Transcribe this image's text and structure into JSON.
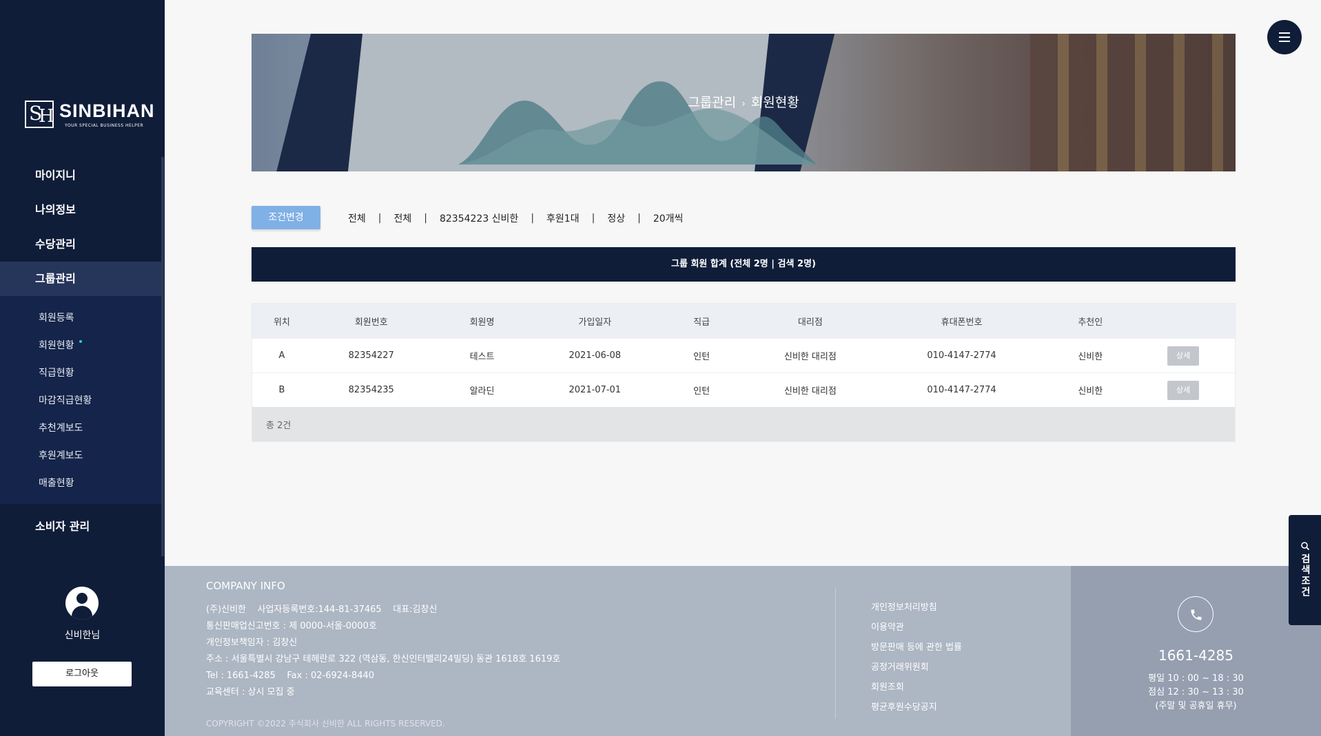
{
  "brand": {
    "name": "SINBIHAN",
    "tagline": "YOUR SPECIAL BUSINESS HELPER"
  },
  "sidebar": {
    "items": [
      {
        "label": "마이지니"
      },
      {
        "label": "나의정보"
      },
      {
        "label": "수당관리"
      },
      {
        "label": "그룹관리"
      }
    ],
    "sub_items": [
      {
        "label": "회원등록"
      },
      {
        "label": "회원현황"
      },
      {
        "label": "직급현황"
      },
      {
        "label": "마감직급현황"
      },
      {
        "label": "추천계보도"
      },
      {
        "label": "후원계보도"
      },
      {
        "label": "매출현황"
      }
    ],
    "consumer": "소비자 관리",
    "user_name": "신비한님",
    "logout": "로그아웃"
  },
  "banner": {
    "section": "그룹관리",
    "separator": "›",
    "page": "회원현황"
  },
  "filter": {
    "button": "조건변경",
    "values": [
      "전체",
      "전체",
      "82354223 신비한",
      "후원1대",
      "정상",
      "20개씩"
    ]
  },
  "summary": "그룹 회원 합계 (전체 2명 | 검색 2명)",
  "table": {
    "headers": [
      "위치",
      "회원번호",
      "회원명",
      "가입일자",
      "직급",
      "대리점",
      "휴대폰번호",
      "추천인",
      ""
    ],
    "rows": [
      [
        "A",
        "82354227",
        "테스트",
        "2021-06-08",
        "인턴",
        "신비한 대리점",
        "010-4147-2774",
        "신비한"
      ],
      [
        "B",
        "82354235",
        "알라딘",
        "2021-07-01",
        "인턴",
        "신비한 대리점",
        "010-4147-2774",
        "신비한"
      ]
    ],
    "detail_label": "상세",
    "total": "총 2건"
  },
  "footer": {
    "title": "COMPANY INFO",
    "lines": [
      "(주)신비한    사업자등록번호:144-81-37465    대표:김창신",
      "통신판매업신고번호 : 제 0000-서울-0000호",
      "개인정보책임자 : 김창신",
      "주소 : 서울특별시 강남구 테헤란로 322 (역삼동, 한신인터밸리24빌딩) 동관 1618호 1619호",
      "Tel : 1661-4285    Fax : 02-6924-8440",
      "교육센터 : 상시 모집 중"
    ],
    "copyright": "COPYRIGHT ©2022 주식회사 신비한 ALL RIGHTS RESERVED.",
    "links": [
      "개인정보처리방침",
      "이용약관",
      "방문판매 등에 관한 법률",
      "공정거래위원회",
      "회원조회",
      "평균후원수당공지"
    ]
  },
  "contact": {
    "phone": "1661-4285",
    "hours": [
      "평일 10 : 00 ~ 18 : 30",
      "점심 12 : 30 ~ 13 : 30",
      "(주말 및 공휴일 휴무)"
    ]
  },
  "search_tab": "검색조건",
  "colors": {
    "navy": "#0f1d38",
    "accent": "#7fb0e6",
    "footer": "#adb6c3",
    "contact": "#959faf"
  }
}
